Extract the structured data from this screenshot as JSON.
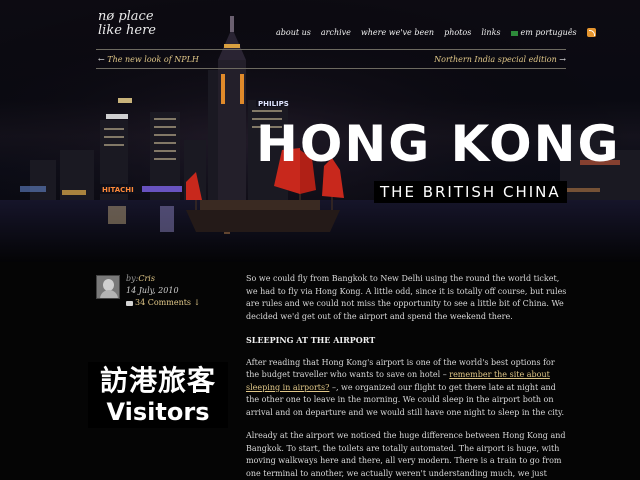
{
  "site": {
    "logo_line1": "nø place",
    "logo_line2": "like here"
  },
  "nav": {
    "items": [
      "about us",
      "archive",
      "where we've been",
      "photos",
      "links"
    ],
    "language_label": "em português",
    "flag_icon": "brazil-flag-icon",
    "rss_icon": "rss-icon"
  },
  "post_nav": {
    "prev_arrow": "←",
    "prev_label": "The new look of NPLH",
    "next_label": "Northern India special edition",
    "next_arrow": "→"
  },
  "hero": {
    "title": "HONG KONG",
    "subtitle": "THE BRITISH CHINA",
    "sign_philips": "PHILIPS",
    "sign_hitachi": "HITACHI"
  },
  "meta": {
    "by_label": "by:",
    "author": "Cris",
    "date": "14 July, 2010",
    "comments": "34 Comments",
    "comments_arrow": "↓"
  },
  "badge": {
    "chinese": "訪港旅客",
    "english": "Visitors"
  },
  "article": {
    "p1": "So we could fly from Bangkok to New Delhi using the round the world ticket, we had to fly via Hong Kong. A little odd, since it is totally off course, but rules are rules and we could not miss the opportunity to see a little bit of China. We decided we'd get out of the airport and spend the weekend there.",
    "heading": "SLEEPING AT THE AIRPORT",
    "p2_before": "After reading that Hong Kong's airport is one of the world's best options for the budget traveller who wants to save on hotel – ",
    "p2_link": "remember the site about sleeping in airports?",
    "p2_after": " –, we organized our flight to get there late at night and the other one to leave in the morning. We could sleep in the airport both on arrival and on departure and we would still have one night to sleep in the city.",
    "p3": "Already at the airport we noticed the huge difference between Hong Kong and Bangkok. To start, the toilets are totally automated. The airport is huge, with moving walkways here and there, all very modern. There is a train to go from one terminal to another, we actually weren't understanding much, we just followed other people. :P"
  },
  "colors": {
    "accent": "#e0c788",
    "sail_red": "#c8281c",
    "background": "#050505"
  }
}
